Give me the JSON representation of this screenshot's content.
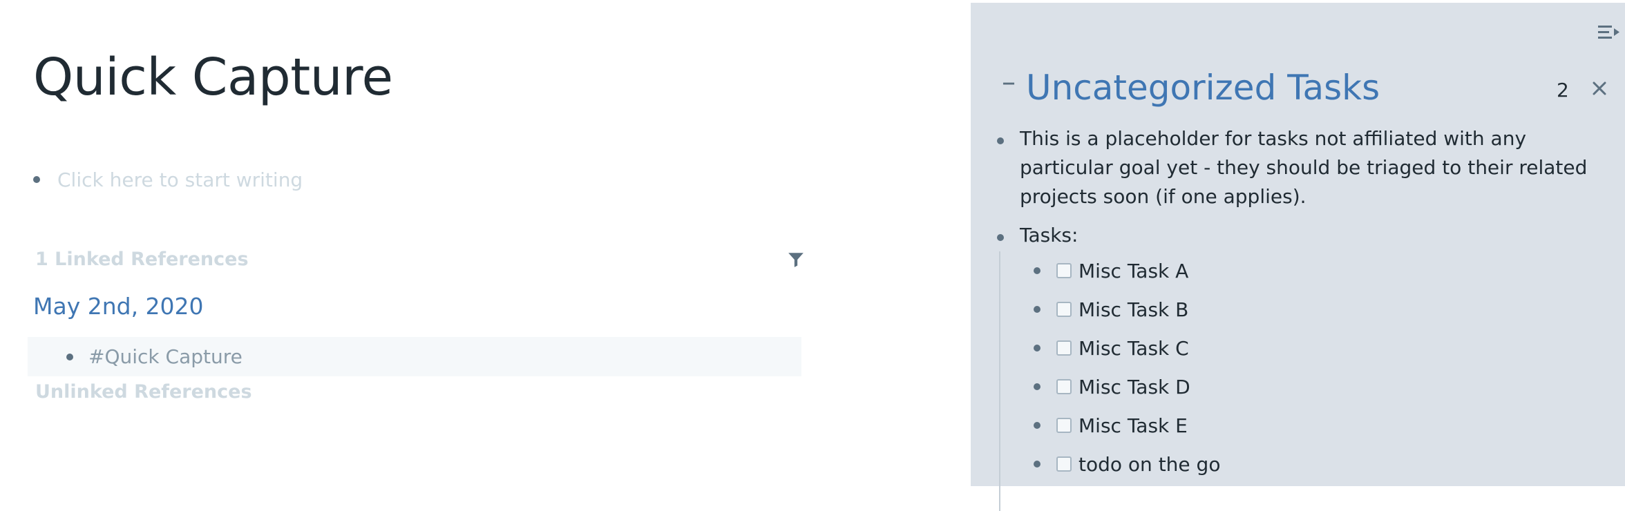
{
  "page": {
    "title": "Quick Capture",
    "placeholder": "Click here to start writing",
    "linked_references": {
      "header": "1 Linked References",
      "groups": [
        {
          "date": "May 2nd, 2020",
          "blocks": [
            "#Quick Capture"
          ]
        }
      ]
    },
    "unlinked_references_header": "Unlinked References"
  },
  "sidebar": {
    "collapse_symbol": "–",
    "title": "Uncategorized Tasks",
    "reference_count": "2",
    "blocks": [
      {
        "text": "This is a placeholder for tasks not affiliated with any particular goal yet - they should be triaged to their related projects soon (if one applies)."
      },
      {
        "text": "Tasks:"
      }
    ],
    "tasks": [
      {
        "label": "Misc Task A",
        "checked": false
      },
      {
        "label": "Misc Task B",
        "checked": false
      },
      {
        "label": "Misc Task C",
        "checked": false
      },
      {
        "label": "Misc Task D",
        "checked": false
      },
      {
        "label": "Misc Task E",
        "checked": false
      },
      {
        "label": "todo on the go",
        "checked": false
      }
    ]
  },
  "icons": {
    "filter": "filter-icon",
    "sidebar_toggle": "sidebar-toggle-icon",
    "close": "close-icon"
  },
  "colors": {
    "link_blue": "#3f76b3",
    "sidebar_bg": "#dbe1e8",
    "muted_text": "#ced9e0",
    "bullet": "#5c7080"
  }
}
